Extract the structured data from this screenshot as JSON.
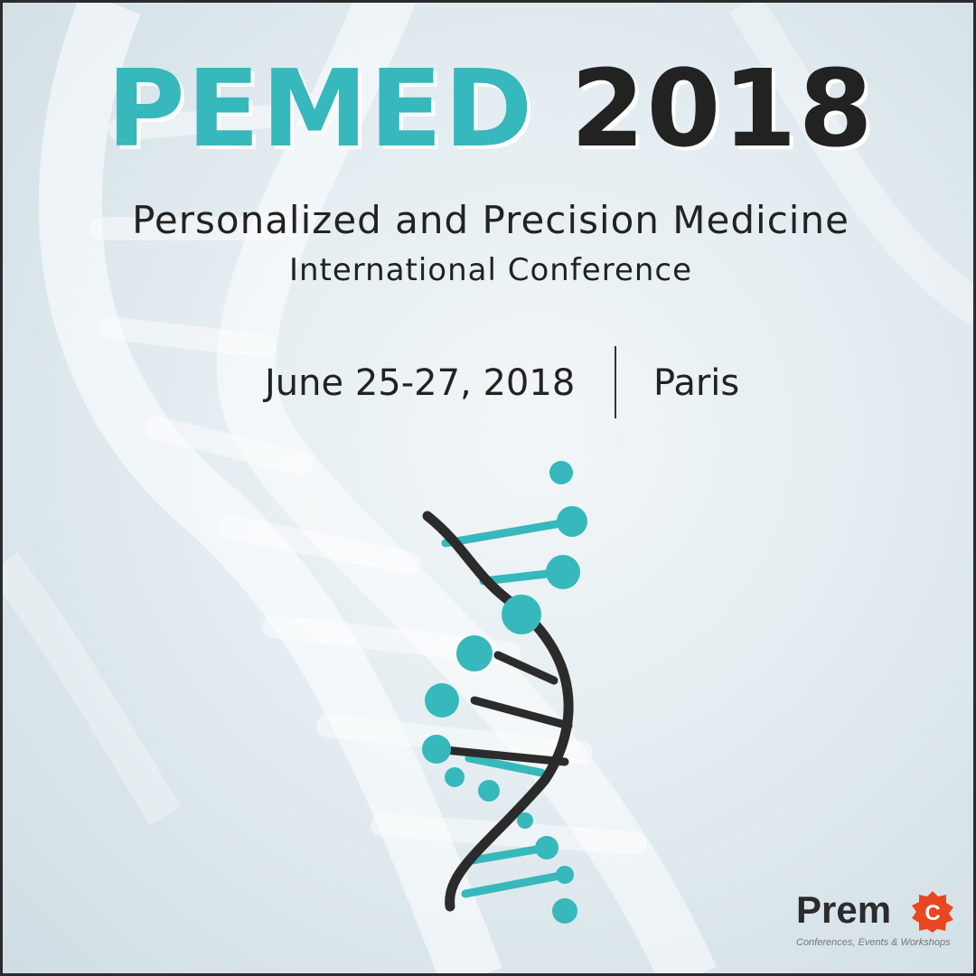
{
  "poster": {
    "acronym": "PEMED",
    "year": "2018",
    "subtitle": "Personalized and Precision Medicine",
    "subtitle2": "International Conference",
    "dates": "June 25-27, 2018",
    "city": "Paris"
  },
  "logo": {
    "word": "Prem",
    "badge_letter": "C",
    "tagline": "Conferences, Events & Workshops"
  },
  "colors": {
    "accent": "#36b8bc",
    "text": "#222222",
    "logo_badge": "#e8471f"
  },
  "icons": [
    "dna-helix-icon",
    "background-dna-illustration",
    "premc-logo"
  ]
}
